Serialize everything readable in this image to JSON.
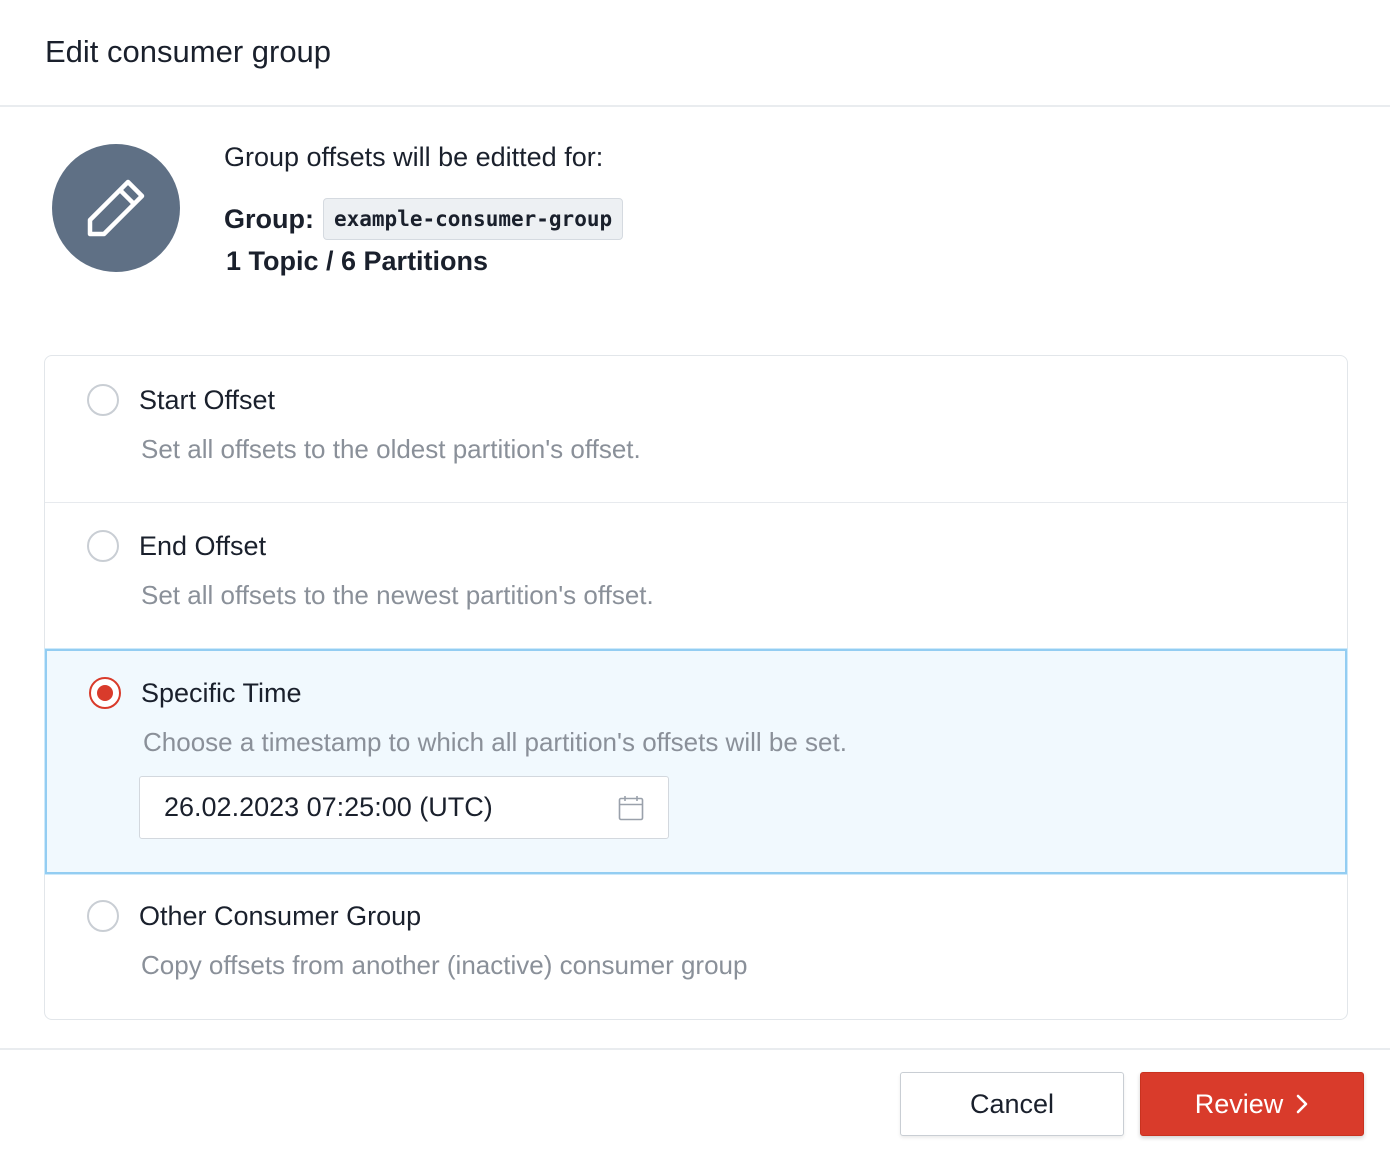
{
  "dialog": {
    "title": "Edit consumer group"
  },
  "summary": {
    "intro": "Group offsets will be editted for:",
    "group_label": "Group:",
    "group_name": "example-consumer-group",
    "topics_partitions": "1 Topic / 6 Partitions",
    "icon": "pencil-icon"
  },
  "options": [
    {
      "title": "Start Offset",
      "description": "Set all offsets to the oldest partition's offset.",
      "selected": false
    },
    {
      "title": "End Offset",
      "description": "Set all offsets to the newest partition's offset.",
      "selected": false
    },
    {
      "title": "Specific Time",
      "description": "Choose a timestamp to which all partition's offsets will be set.",
      "selected": true,
      "timestamp": "26.02.2023 07:25:00 (UTC)",
      "timestamp_icon": "calendar-icon"
    },
    {
      "title": "Other Consumer Group",
      "description": "Copy offsets from another (inactive) consumer group",
      "selected": false
    }
  ],
  "footer": {
    "cancel_label": "Cancel",
    "review_label": "Review",
    "review_icon": "chevron-right-icon"
  },
  "colors": {
    "accent": "#d93b2b",
    "avatar_bg": "#5f7085",
    "selected_bg": "#f1f9fe",
    "selected_border": "#93cdf2"
  }
}
